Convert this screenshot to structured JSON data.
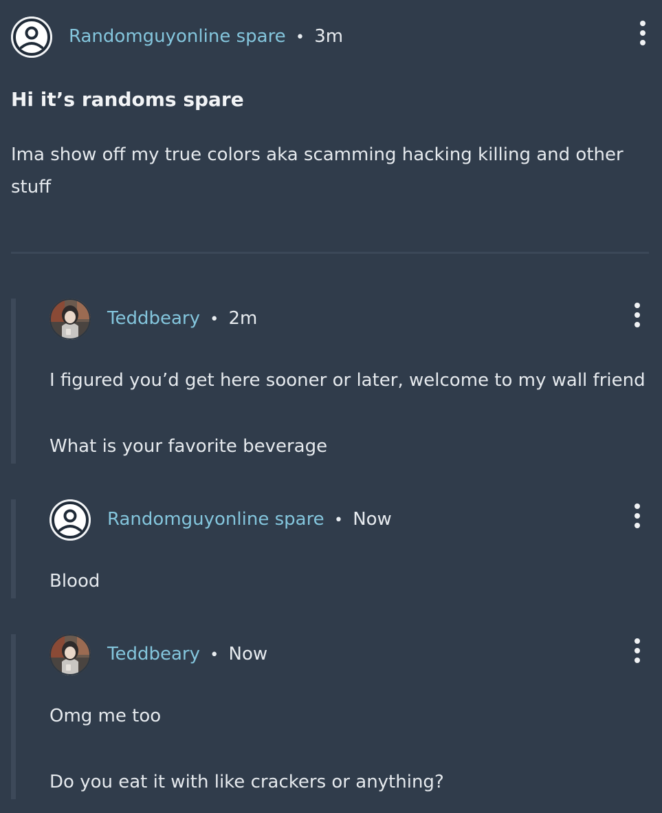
{
  "post": {
    "author": "Randomguyonline spare",
    "separator": "•",
    "time": "3m",
    "avatar_icon": "default-user-icon",
    "title": "Hi it’s randoms spare",
    "body": "Ima show off my true colors aka scamming hacking killing and other stuff"
  },
  "replies": [
    {
      "author": "Teddbeary",
      "separator": "•",
      "time": "2m",
      "avatar_icon": "profile-photo",
      "lines": [
        "I figured you’d get here sooner or later, welcome to my wall friend",
        "What is your favorite beverage"
      ]
    },
    {
      "author": "Randomguyonline spare",
      "separator": "•",
      "time": "Now",
      "avatar_icon": "default-user-icon",
      "lines": [
        "Blood"
      ]
    },
    {
      "author": "Teddbeary",
      "separator": "•",
      "time": "Now",
      "avatar_icon": "profile-photo",
      "lines": [
        "Omg me too",
        "Do you eat it with like crackers or anything?"
      ]
    }
  ],
  "colors": {
    "background": "#303c4b",
    "author_link": "#84c6dd",
    "text": "#e6eaee",
    "thread_bar": "#3d4959"
  }
}
